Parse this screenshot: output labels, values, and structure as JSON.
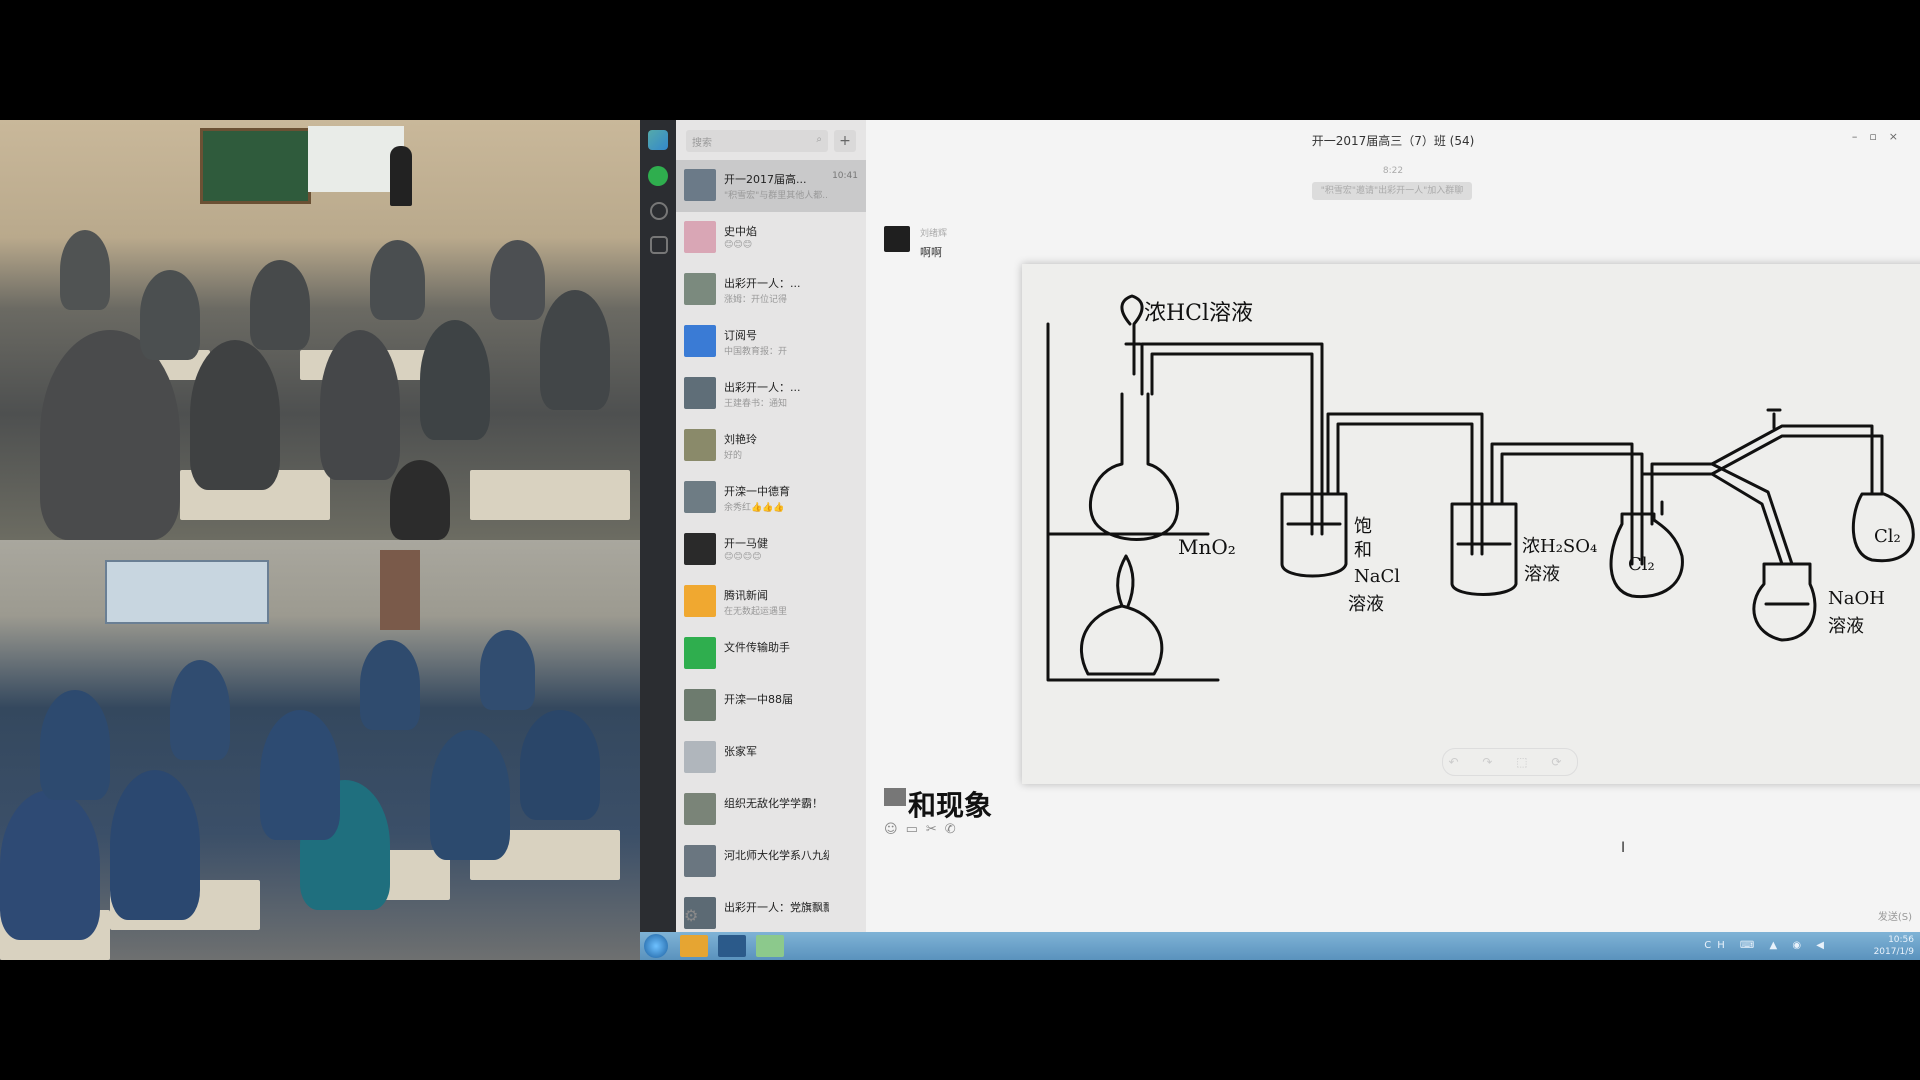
{
  "window": {
    "title": "开一2017届高三（7）班 (54)",
    "controls": [
      "–",
      "▫",
      "×"
    ]
  },
  "search": {
    "placeholder": "搜索"
  },
  "chat_list": [
    {
      "name": "开一2017届高...",
      "preview": "\"积雪宏\"与群里其他人都...",
      "time": "10:41",
      "active": true,
      "color": "#6b7a88"
    },
    {
      "name": "史中焰",
      "preview": "😊😊😊",
      "time": "",
      "active": false,
      "color": "#d9a6b5"
    },
    {
      "name": "出彩开一人：...",
      "preview": "涨姆：开位记得",
      "time": "",
      "active": false,
      "color": "#7b8a7e"
    },
    {
      "name": "订阅号",
      "preview": "中国教育报：开",
      "time": "",
      "active": false,
      "color": "#3a7bd5"
    },
    {
      "name": "出彩开一人：...",
      "preview": "王建春书：通知",
      "time": "",
      "active": false,
      "color": "#5f6e78"
    },
    {
      "name": "刘艳玲",
      "preview": "好的",
      "time": "",
      "active": false,
      "color": "#8a8a6a"
    },
    {
      "name": "开滦一中德育",
      "preview": "余秀红👍👍👍",
      "time": "",
      "active": false,
      "color": "#6e7c84"
    },
    {
      "name": "开一马健",
      "preview": "😊😊😊😊",
      "time": "",
      "active": false,
      "color": "#2a2a2a"
    },
    {
      "name": "腾讯新闻",
      "preview": "在无数起运遇里",
      "time": "",
      "active": false,
      "color": "#f0a830"
    },
    {
      "name": "文件传输助手",
      "preview": "",
      "time": "",
      "active": false,
      "color": "#2fae4e"
    },
    {
      "name": "开滦一中88届",
      "preview": "",
      "time": "",
      "active": false,
      "color": "#6d7b6e"
    },
    {
      "name": "张家军",
      "preview": "",
      "time": "",
      "active": false,
      "color": "#b0b6bc"
    },
    {
      "name": "组织无敌化学学霸！",
      "preview": "",
      "time": "",
      "active": false,
      "color": "#7a8478"
    },
    {
      "name": "河北师大化学系八九级",
      "preview": "",
      "time": "",
      "active": false,
      "color": "#6a7680"
    },
    {
      "name": "出彩开一人：党旗飘飘🚩",
      "preview": "",
      "time": "",
      "active": false,
      "color": "#5c6a74"
    }
  ],
  "chat": {
    "time": "8:22",
    "system_notice": "\"积雪宏\"邀请\"出彩开一人\"加入群聊",
    "sender": "刘绪辉",
    "message": "啊啊",
    "input_text": "和现象",
    "send_label": "发送(S)"
  },
  "diagram_labels": {
    "hcl": "浓HCl溶液",
    "mno2": "MnO₂",
    "nacl_1": "饱",
    "nacl_2": "和",
    "nacl_3": "NaCl",
    "nacl_4": "溶液",
    "h2so4_1": "浓H₂SO₄",
    "h2so4_2": "溶液",
    "cl2_a": "Cl₂",
    "cl2_b": "Cl₂",
    "naoh_1": "NaOH",
    "naoh_2": "溶液"
  },
  "viewer": {
    "close": "×",
    "tools": "↶ ↷ ⬚ ⟳"
  },
  "taskbar": {
    "time": "10:56",
    "date": "2017/1/9",
    "tray_icons": "CH ⌨ ▲ ◉ ◀"
  },
  "colors": {
    "accent": "#2fae4e",
    "rail": "#2b2d31",
    "taskbar": "#5a92bd"
  }
}
